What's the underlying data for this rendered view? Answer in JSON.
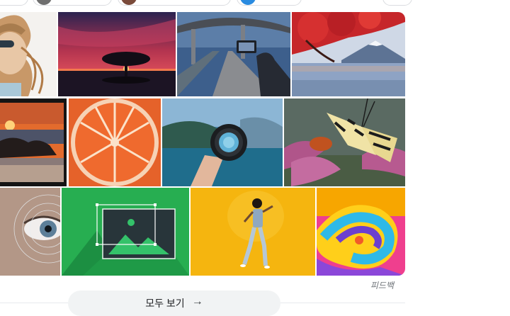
{
  "feedback_label": "피드백",
  "see_all": {
    "label": "모두 보기",
    "icon": "arrow-right-icon"
  },
  "images": [
    {
      "id": "tile-woman-hat",
      "subject": "woman-with-hat-icon"
    },
    {
      "id": "tile-tree-sunset",
      "subject": "tree-sunset-icon"
    },
    {
      "id": "tile-phone-road",
      "subject": "phone-photo-road-icon"
    },
    {
      "id": "tile-fuji-maple",
      "subject": "mount-fuji-icon"
    },
    {
      "id": "tile-beach-sunset",
      "subject": "beach-sunset-icon"
    },
    {
      "id": "tile-orange-slice",
      "subject": "orange-slice-icon"
    },
    {
      "id": "tile-lens-lake",
      "subject": "camera-lens-icon"
    },
    {
      "id": "tile-butterfly",
      "subject": "butterfly-icon"
    },
    {
      "id": "tile-eye",
      "subject": "eye-icon"
    },
    {
      "id": "tile-image-placeholder",
      "subject": "image-placeholder-icon"
    },
    {
      "id": "tile-dancer",
      "subject": "dancer-icon"
    },
    {
      "id": "tile-swirl",
      "subject": "abstract-swirl-icon"
    }
  ]
}
